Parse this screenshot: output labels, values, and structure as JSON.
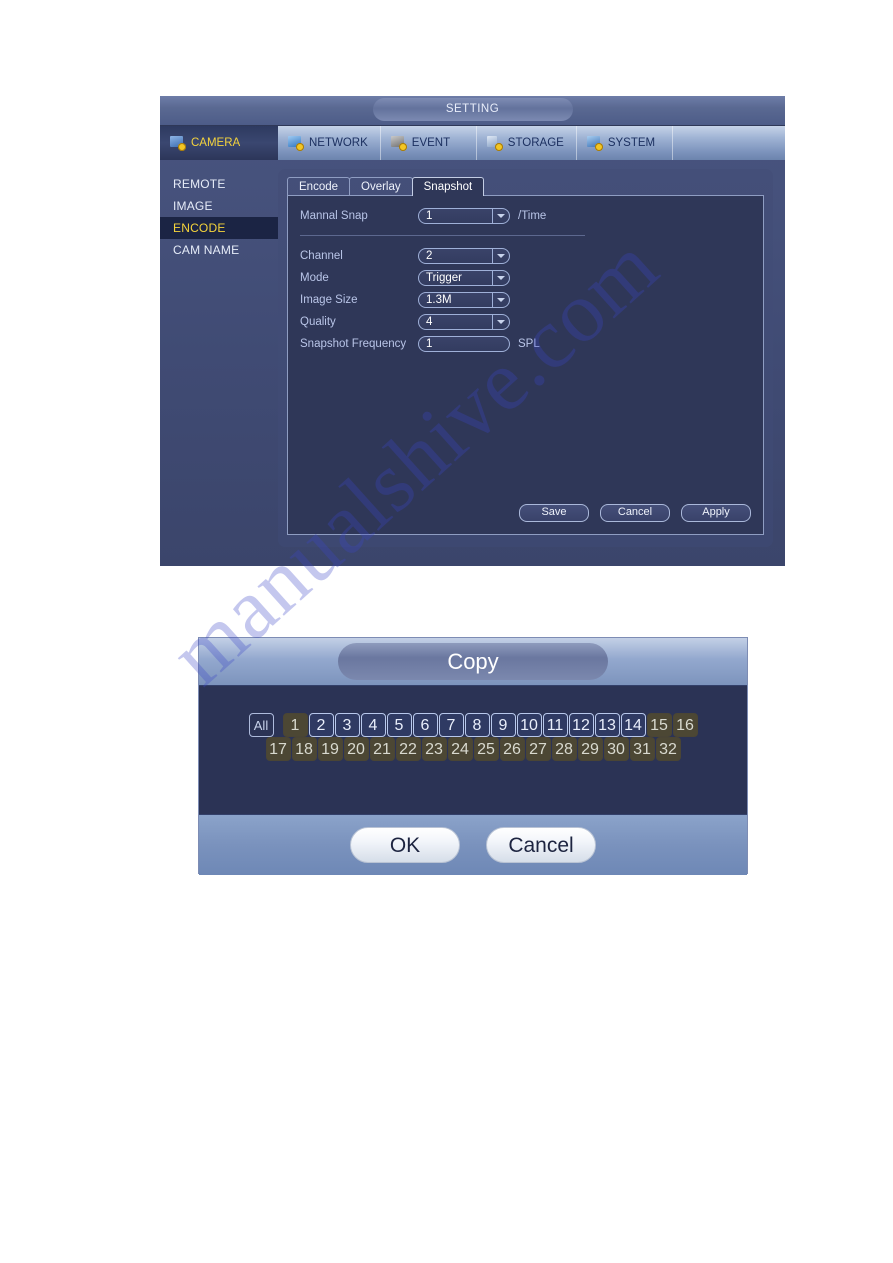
{
  "setting_window": {
    "title": "SETTING",
    "nav": [
      {
        "label": "CAMERA",
        "icon": "camera-icon",
        "active": true
      },
      {
        "label": "NETWORK",
        "icon": "network-icon",
        "active": false
      },
      {
        "label": "EVENT",
        "icon": "event-icon",
        "active": false
      },
      {
        "label": "STORAGE",
        "icon": "storage-icon",
        "active": false
      },
      {
        "label": "SYSTEM",
        "icon": "system-icon",
        "active": false
      }
    ],
    "sidebar": [
      {
        "label": "REMOTE",
        "active": false
      },
      {
        "label": "IMAGE",
        "active": false
      },
      {
        "label": "ENCODE",
        "active": true
      },
      {
        "label": "CAM NAME",
        "active": false
      }
    ],
    "tabs": [
      {
        "label": "Encode",
        "active": false
      },
      {
        "label": "Overlay",
        "active": false
      },
      {
        "label": "Snapshot",
        "active": true
      }
    ],
    "form": {
      "manual_snap": {
        "label": "Mannal Snap",
        "value": "1",
        "unit": "/Time",
        "control": "combo"
      },
      "channel": {
        "label": "Channel",
        "value": "2",
        "unit": "",
        "control": "combo"
      },
      "mode": {
        "label": "Mode",
        "value": "Trigger",
        "unit": "",
        "control": "combo"
      },
      "image_size": {
        "label": "Image Size",
        "value": "1.3M",
        "unit": "",
        "control": "combo"
      },
      "quality": {
        "label": "Quality",
        "value": "4",
        "unit": "",
        "control": "combo"
      },
      "snapshot_frequency": {
        "label": "Snapshot Frequency",
        "value": "1",
        "unit": "SPL",
        "control": "text"
      }
    },
    "buttons": {
      "save": "Save",
      "cancel": "Cancel",
      "apply": "Apply"
    }
  },
  "copy_dialog": {
    "title": "Copy",
    "all_label": "All",
    "channels": [
      {
        "label": "1",
        "state": "off"
      },
      {
        "label": "2",
        "state": "sel"
      },
      {
        "label": "3",
        "state": "sel"
      },
      {
        "label": "4",
        "state": "sel"
      },
      {
        "label": "5",
        "state": "sel"
      },
      {
        "label": "6",
        "state": "sel"
      },
      {
        "label": "7",
        "state": "sel"
      },
      {
        "label": "8",
        "state": "sel"
      },
      {
        "label": "9",
        "state": "sel"
      },
      {
        "label": "10",
        "state": "sel"
      },
      {
        "label": "11",
        "state": "sel"
      },
      {
        "label": "12",
        "state": "sel"
      },
      {
        "label": "13",
        "state": "sel"
      },
      {
        "label": "14",
        "state": "sel"
      },
      {
        "label": "15",
        "state": "off"
      },
      {
        "label": "16",
        "state": "off"
      },
      {
        "label": "17",
        "state": "off"
      },
      {
        "label": "18",
        "state": "off"
      },
      {
        "label": "19",
        "state": "off"
      },
      {
        "label": "20",
        "state": "off"
      },
      {
        "label": "21",
        "state": "off"
      },
      {
        "label": "22",
        "state": "off"
      },
      {
        "label": "23",
        "state": "off"
      },
      {
        "label": "24",
        "state": "off"
      },
      {
        "label": "25",
        "state": "off"
      },
      {
        "label": "26",
        "state": "off"
      },
      {
        "label": "27",
        "state": "off"
      },
      {
        "label": "28",
        "state": "off"
      },
      {
        "label": "29",
        "state": "off"
      },
      {
        "label": "30",
        "state": "off"
      },
      {
        "label": "31",
        "state": "off"
      },
      {
        "label": "32",
        "state": "off"
      }
    ],
    "buttons": {
      "ok": "OK",
      "cancel": "Cancel"
    }
  },
  "watermark": {
    "text": "manualshive.com"
  },
  "colors": {
    "accent_yellow": "#f5d43b",
    "panel_bg": "#2f3758",
    "window_bg": "#404b74",
    "titlebar": "#5a6992",
    "label_blue": "#b9c5e8",
    "channel_off": "#4c4734"
  }
}
